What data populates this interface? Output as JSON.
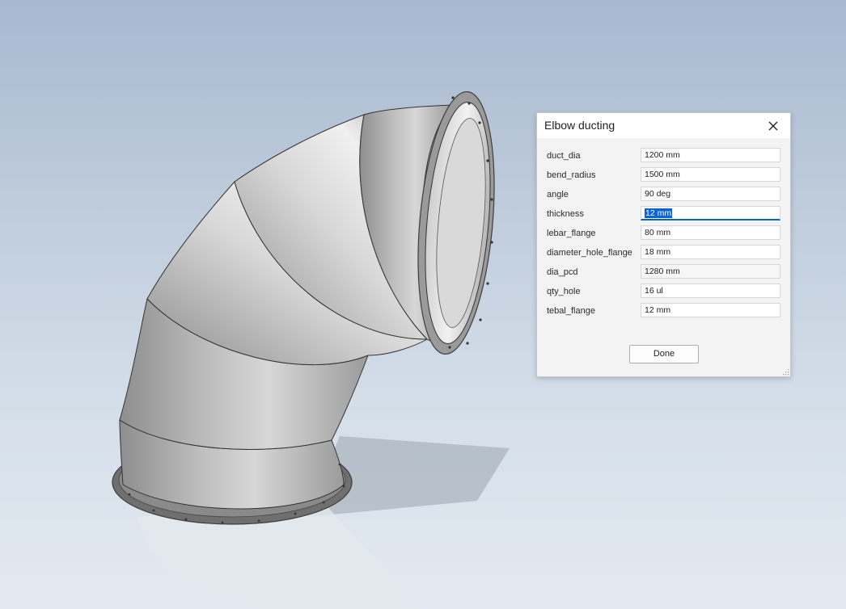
{
  "dialog": {
    "title": "Elbow ducting",
    "done_label": "Done",
    "params": [
      {
        "label": "duct_dia",
        "value": "1200 mm"
      },
      {
        "label": "bend_radius",
        "value": "1500 mm"
      },
      {
        "label": "angle",
        "value": "90 deg"
      },
      {
        "label": "thickness",
        "value": "12 mm"
      },
      {
        "label": "lebar_flange",
        "value": "80 mm"
      },
      {
        "label": "diameter_hole_flange",
        "value": "18 mm"
      },
      {
        "label": "dia_pcd",
        "value": "1280 mm"
      },
      {
        "label": "qty_hole",
        "value": "16 ul"
      },
      {
        "label": "tebal_flange",
        "value": "12 mm"
      }
    ]
  },
  "colors": {
    "selection": "#0a64d8",
    "metal": "#a9a9a9"
  }
}
